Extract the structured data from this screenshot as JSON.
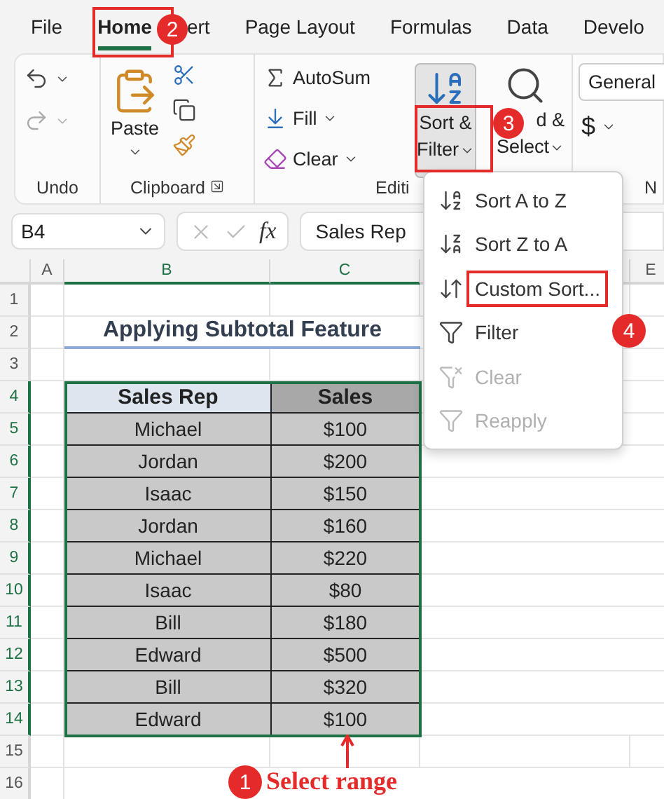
{
  "tabs": [
    {
      "label": "File",
      "selected": false
    },
    {
      "label": "Home",
      "selected": true
    },
    {
      "label": "ert",
      "selected": false
    },
    {
      "label": "Page Layout",
      "selected": false
    },
    {
      "label": "Formulas",
      "selected": false
    },
    {
      "label": "Data",
      "selected": false
    },
    {
      "label": "Develo",
      "selected": false
    }
  ],
  "ribbon": {
    "undo": {
      "label": "Undo"
    },
    "clipboard": {
      "label": "Clipboard",
      "paste": "Paste"
    },
    "editing": {
      "label": "Editi",
      "autosum": "AutoSum",
      "fill": "Fill",
      "clear": "Clear",
      "sort_filter": [
        "Sort &",
        "Filter"
      ],
      "find_select": [
        "d &",
        "Select"
      ]
    },
    "number": {
      "format": "General",
      "currency": "$",
      "label": "N"
    }
  },
  "formula_bar": {
    "name_box": "B4",
    "fx": "fx",
    "value": "Sales Rep"
  },
  "columns": [
    "A",
    "B",
    "C",
    "E"
  ],
  "row_numbers": [
    "1",
    "2",
    "3",
    "4",
    "5",
    "6",
    "7",
    "8",
    "9",
    "10",
    "11",
    "12",
    "13",
    "14",
    "15",
    "16"
  ],
  "title": "Applying Subtotal Feature",
  "table": {
    "columns": [
      "Sales Rep",
      "Sales"
    ],
    "rows": [
      [
        "Michael",
        "$100"
      ],
      [
        "Jordan",
        "$200"
      ],
      [
        "Isaac",
        "$150"
      ],
      [
        "Jordan",
        "$160"
      ],
      [
        "Michael",
        "$220"
      ],
      [
        "Isaac",
        "$80"
      ],
      [
        "Bill",
        "$180"
      ],
      [
        "Edward",
        "$500"
      ],
      [
        "Bill",
        "$320"
      ],
      [
        "Edward",
        "$100"
      ]
    ]
  },
  "menu": {
    "items": [
      {
        "kind": "az",
        "label": "Sort A to Z",
        "disabled": false
      },
      {
        "kind": "za",
        "label": "Sort Z to A",
        "disabled": false
      },
      {
        "kind": "custom",
        "label": "Custom Sort...",
        "disabled": false,
        "annotated": true
      },
      {
        "kind": "filter",
        "label": "Filter",
        "disabled": false
      },
      {
        "kind": "clear",
        "label": "Clear",
        "disabled": true
      },
      {
        "kind": "reapply",
        "label": "Reapply",
        "disabled": true
      }
    ]
  },
  "steps": [
    "1",
    "2",
    "3",
    "4"
  ],
  "select_range": "Select range"
}
